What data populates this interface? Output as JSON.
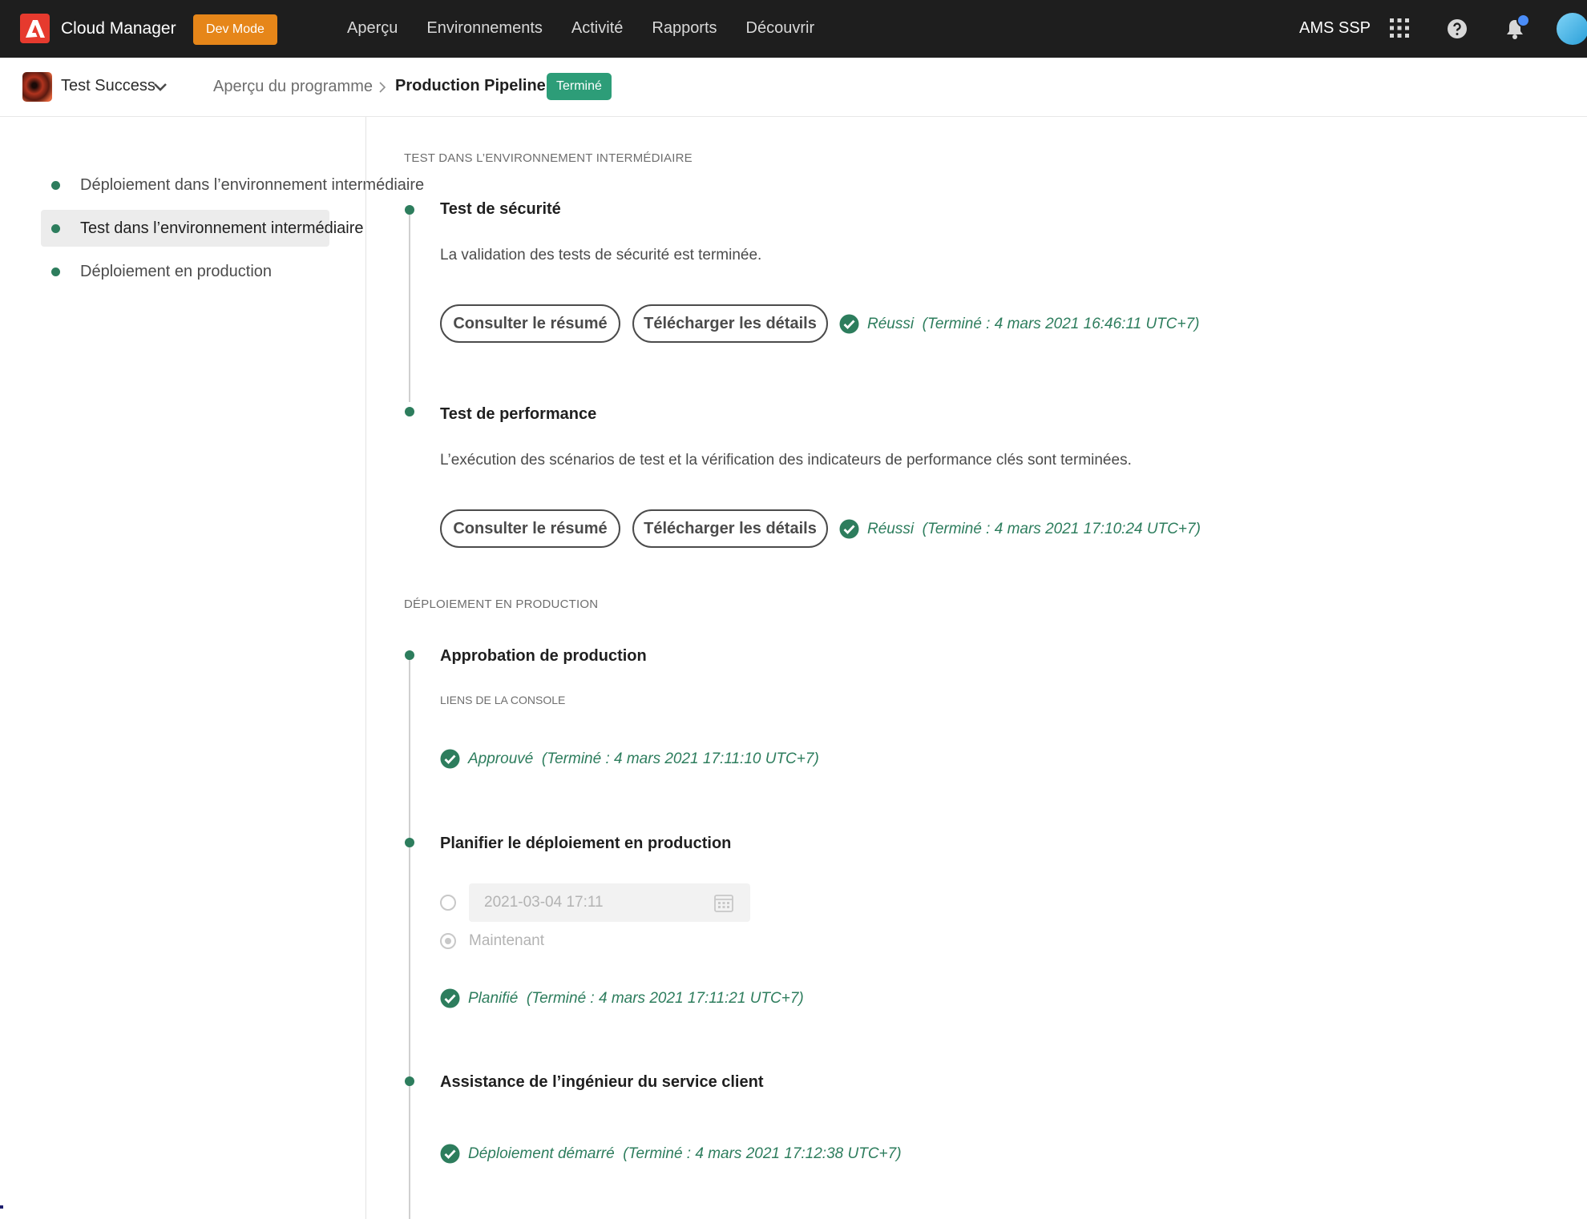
{
  "topbar": {
    "app_title": "Cloud Manager",
    "dev_mode_label": "Dev Mode",
    "nav": [
      "Aperçu",
      "Environnements",
      "Activité",
      "Rapports",
      "Découvrir"
    ],
    "org_name": "AMS SSP",
    "icons": [
      "adobe-logo",
      "apps-icon",
      "help-icon",
      "bell-icon",
      "avatar"
    ],
    "accent_color": "#e68619"
  },
  "subheader": {
    "program_name": "Test Success",
    "breadcrumb_parent": "Aperçu du programme",
    "breadcrumb_current": "Production Pipeline",
    "status_badge": "Terminé",
    "status_color": "#2d9d78"
  },
  "leftnav": {
    "items": [
      {
        "label": "Déploiement dans l’environnement intermédiaire",
        "active": false
      },
      {
        "label": "Test dans l’environnement intermédiaire",
        "active": true
      },
      {
        "label": "Déploiement en production",
        "active": false
      }
    ]
  },
  "main": {
    "section_stage_test": "TEST DANS L’ENVIRONNEMENT INTERMÉDIAIRE",
    "security": {
      "title": "Test de sécurité",
      "description": "La validation des tests de sécurité est terminée.",
      "summary_button": "Consulter le résumé",
      "download_button": "Télécharger les détails",
      "status": "Réussi",
      "completed": "(Terminé : 4 mars 2021 16:46:11 UTC+7)"
    },
    "performance": {
      "title": "Test de performance",
      "description": "L’exécution des scénarios de test et la vérification des indicateurs de performance clés sont terminées.",
      "summary_button": "Consulter le résumé",
      "download_button": "Télécharger les détails",
      "status": "Réussi",
      "completed": "(Terminé : 4 mars 2021 17:10:24 UTC+7)"
    },
    "section_production": "DÉPLOIEMENT EN PRODUCTION",
    "approval": {
      "title": "Approbation de production",
      "console_links_label": "LIENS DE LA CONSOLE",
      "status": "Approuvé",
      "completed": "(Terminé : 4 mars 2021 17:11:10 UTC+7)"
    },
    "schedule": {
      "title": "Planifier le déploiement en production",
      "date_value": "2021-03-04 17:11",
      "now_label": "Maintenant",
      "status": "Planifié",
      "completed": "(Terminé : 4 mars 2021 17:11:21 UTC+7)"
    },
    "cse": {
      "title": "Assistance de l’ingénieur du service client",
      "status": "Déploiement démarré",
      "completed": "(Terminé : 4 mars 2021 17:12:38 UTC+7)"
    },
    "success_color": "#2d7d5d"
  }
}
